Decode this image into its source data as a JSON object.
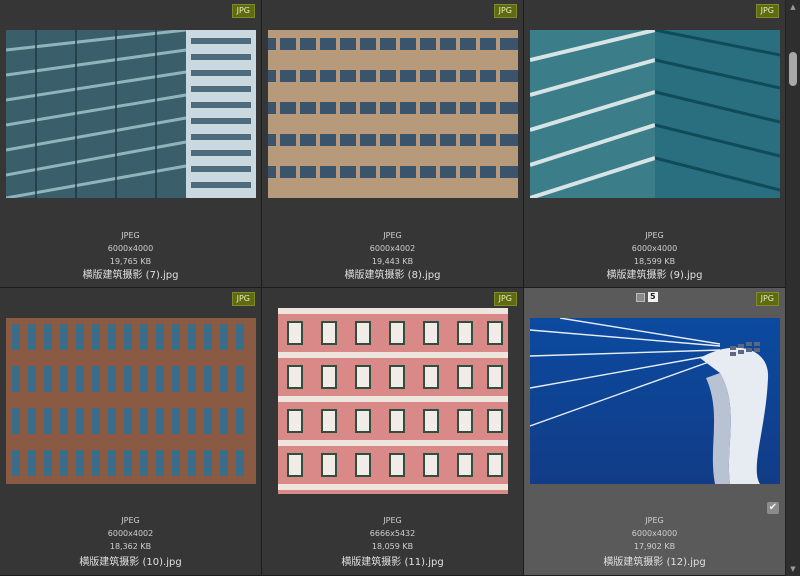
{
  "items": [
    {
      "badge": "JPG",
      "format": "JPEG",
      "dimensions": "6000x4000",
      "size": "19,765 KB",
      "filename": "横版建筑摄影 (7).jpg"
    },
    {
      "badge": "JPG",
      "format": "JPEG",
      "dimensions": "6000x4002",
      "size": "19,443 KB",
      "filename": "横版建筑摄影 (8).jpg"
    },
    {
      "badge": "JPG",
      "format": "JPEG",
      "dimensions": "6000x4000",
      "size": "18,599 KB",
      "filename": "横版建筑摄影 (9).jpg"
    },
    {
      "badge": "JPG",
      "format": "JPEG",
      "dimensions": "6000x4002",
      "size": "18,362 KB",
      "filename": "横版建筑摄影 (10).jpg"
    },
    {
      "badge": "JPG",
      "format": "JPEG",
      "dimensions": "6666x5432",
      "size": "18,059 KB",
      "filename": "横版建筑摄影 (11).jpg"
    },
    {
      "badge": "JPG",
      "format": "JPEG",
      "dimensions": "6000x4000",
      "size": "17,902 KB",
      "filename": "横版建筑摄影 (12).jpg",
      "stack_count": "5",
      "selected": true
    }
  ],
  "colors": {
    "background": "#2b2b2b",
    "cell": "#363636",
    "selected_cell": "#5a5a5a",
    "badge": "#5f6a12"
  },
  "icons": {
    "check": "checkmark-icon",
    "scroll_up": "chevron-up-icon",
    "scroll_down": "chevron-down-icon"
  }
}
